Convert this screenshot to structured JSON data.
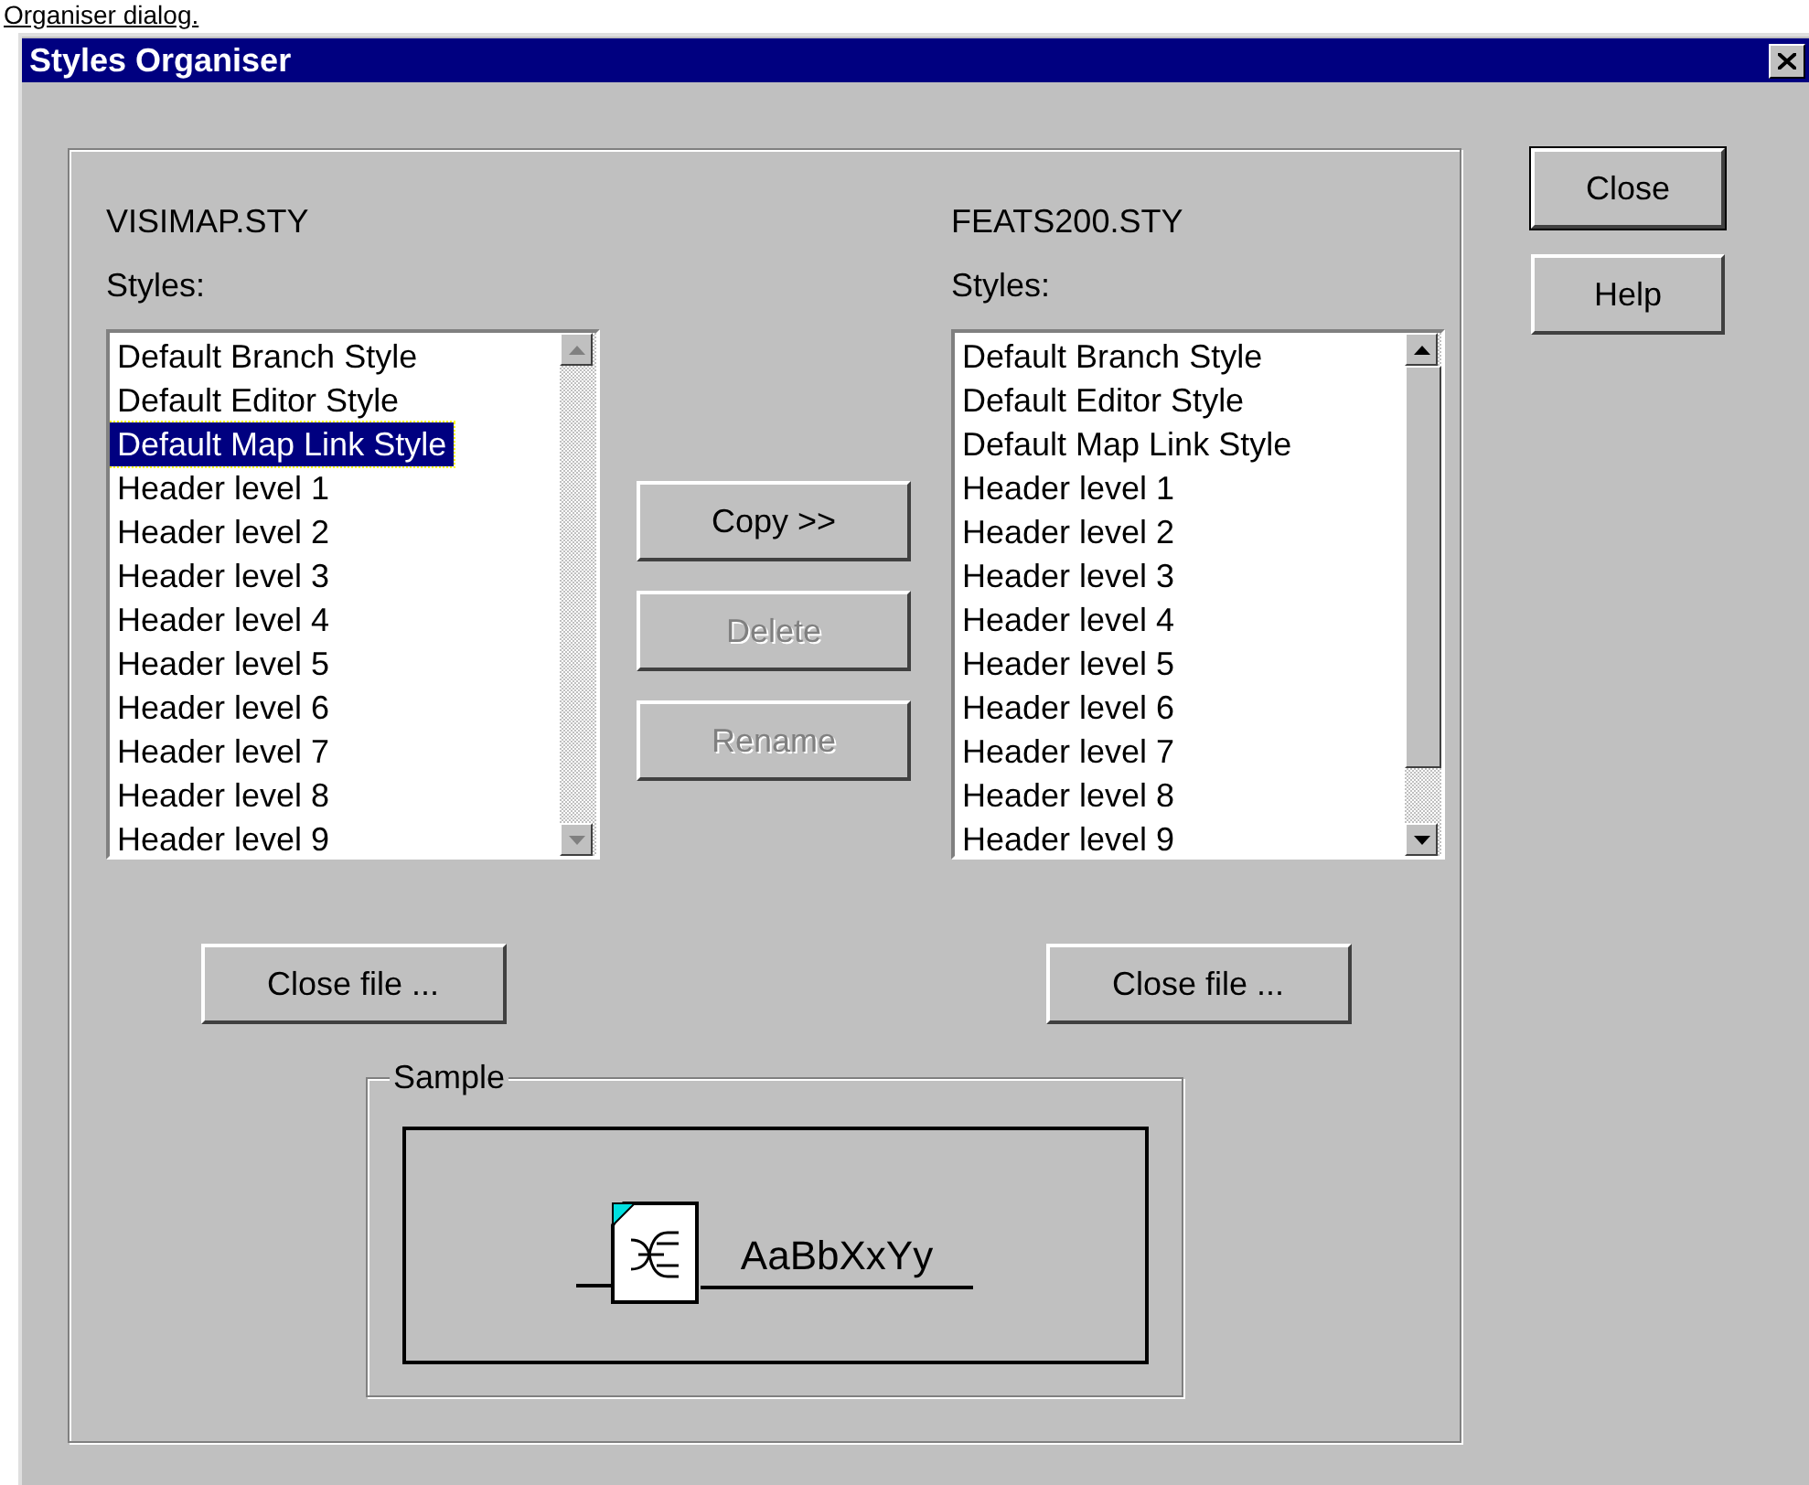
{
  "caption": "Organiser dialog.",
  "window": {
    "title": "Styles Organiser"
  },
  "left": {
    "file": "VISIMAP.STY",
    "label": "Styles:",
    "items": [
      {
        "text": "Default Branch Style",
        "selected": false
      },
      {
        "text": "Default Editor Style",
        "selected": false
      },
      {
        "text": "Default Map Link Style",
        "selected": true
      },
      {
        "text": "Header level 1",
        "selected": false
      },
      {
        "text": "Header level 2",
        "selected": false
      },
      {
        "text": "Header level 3",
        "selected": false
      },
      {
        "text": "Header level 4",
        "selected": false
      },
      {
        "text": "Header level 5",
        "selected": false
      },
      {
        "text": "Header level 6",
        "selected": false
      },
      {
        "text": "Header level 7",
        "selected": false
      },
      {
        "text": "Header level 8",
        "selected": false
      },
      {
        "text": "Header level 9",
        "selected": false
      }
    ],
    "disabled_scroll": true,
    "close_file": "Close file ..."
  },
  "middle_buttons": [
    {
      "label": "Copy >>",
      "disabled": false
    },
    {
      "label": "Delete",
      "disabled": true
    },
    {
      "label": "Rename",
      "disabled": true
    }
  ],
  "right": {
    "file": "FEATS200.STY",
    "label": "Styles:",
    "items": [
      {
        "text": "Default Branch Style",
        "selected": false
      },
      {
        "text": "Default Editor Style",
        "selected": false
      },
      {
        "text": "Default Map Link Style",
        "selected": false
      },
      {
        "text": "Header level 1",
        "selected": false
      },
      {
        "text": "Header level 2",
        "selected": false
      },
      {
        "text": "Header level 3",
        "selected": false
      },
      {
        "text": "Header level 4",
        "selected": false
      },
      {
        "text": "Header level 5",
        "selected": false
      },
      {
        "text": "Header level 6",
        "selected": false
      },
      {
        "text": "Header level 7",
        "selected": false
      },
      {
        "text": "Header level 8",
        "selected": false
      },
      {
        "text": "Header level 9",
        "selected": false
      }
    ],
    "disabled_scroll": false,
    "close_file": "Close file ..."
  },
  "sample": {
    "legend": "Sample",
    "text": "AaBbXxYy"
  },
  "side_buttons": [
    {
      "label": "Close",
      "default": true
    },
    {
      "label": "Help",
      "default": false
    }
  ]
}
